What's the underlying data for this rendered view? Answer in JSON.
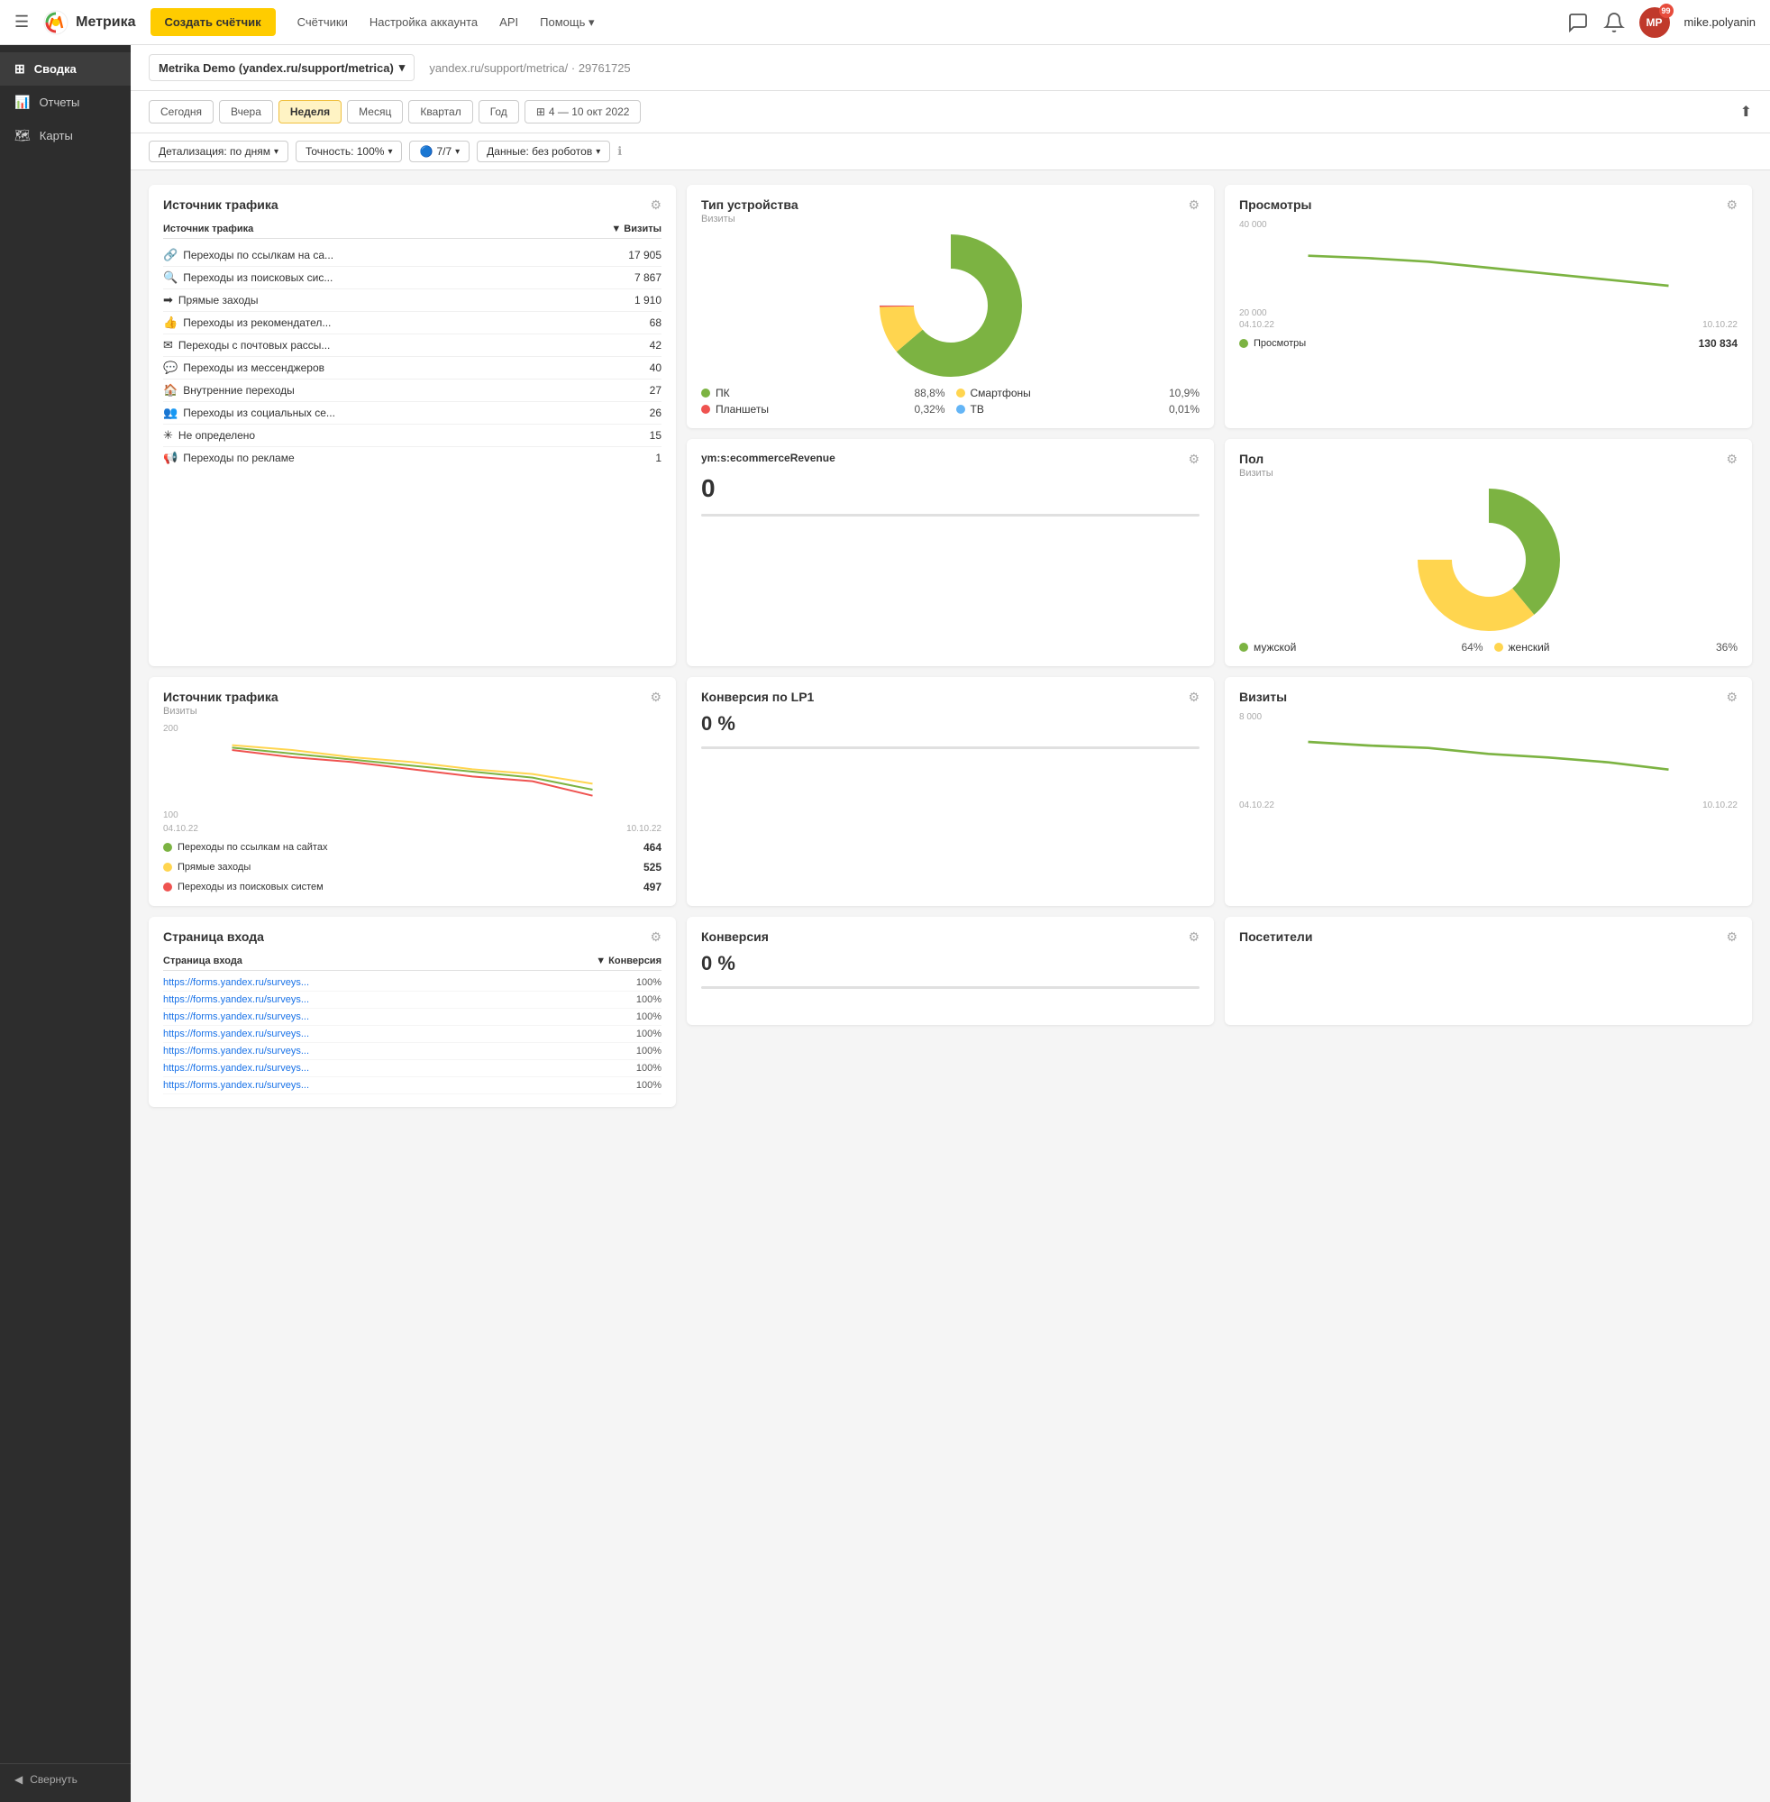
{
  "header": {
    "menu_icon": "☰",
    "logo_text": "Метрика",
    "create_btn": "Создать счётчик",
    "nav": [
      "Счётчики",
      "Настройка аккаунта",
      "API",
      "Помощь ▾"
    ],
    "username": "mike.polyanin",
    "notification_count": "99"
  },
  "sidebar": {
    "items": [
      {
        "label": "Сводка",
        "icon": "⊞",
        "active": true
      },
      {
        "label": "Отчеты",
        "icon": "📊",
        "active": false
      },
      {
        "label": "Карты",
        "icon": "🗺",
        "active": false
      }
    ],
    "collapse_label": "Свернуть"
  },
  "account": {
    "name": "Metrika Demo (yandex.ru/support/metrica)",
    "url": "yandex.ru/support/metrica/",
    "id": "29761725"
  },
  "date_filters": {
    "buttons": [
      "Сегодня",
      "Вчера",
      "Неделя",
      "Месяц",
      "Квартал",
      "Год"
    ],
    "active": "Неделя",
    "range_icon": "⊞",
    "range": "4 — 10 окт 2022",
    "export_icon": "⬆"
  },
  "detail_filters": {
    "detail": "Детализация: по дням",
    "accuracy": "Точность: 100%",
    "counters": "7/7",
    "data": "Данные: без роботов",
    "info_icon": "ℹ"
  },
  "widgets": {
    "traffic_source": {
      "title": "Источник трафика",
      "gear": "⚙",
      "col_source": "Источник трафика",
      "col_visits": "▼ Визиты",
      "rows": [
        {
          "icon": "🔗",
          "color": "#4a9fd4",
          "name": "Переходы по ссылкам на са...",
          "value": "17 905"
        },
        {
          "icon": "🔍",
          "color": "#e67e22",
          "name": "Переходы из поисковых сис...",
          "value": "7 867"
        },
        {
          "icon": "➡",
          "color": "#7f8c8d",
          "name": "Прямые заходы",
          "value": "1 910"
        },
        {
          "icon": "👍",
          "color": "#e91e8c",
          "name": "Переходы из рекомендател...",
          "value": "68"
        },
        {
          "icon": "✉",
          "color": "#e67e22",
          "name": "Переходы с почтовых рассы...",
          "value": "42"
        },
        {
          "icon": "💬",
          "color": "#3498db",
          "name": "Переходы из мессенджеров",
          "value": "40"
        },
        {
          "icon": "🏠",
          "color": "#27ae60",
          "name": "Внутренние переходы",
          "value": "27"
        },
        {
          "icon": "👥",
          "color": "#9b59b6",
          "name": "Переходы из социальных се...",
          "value": "26"
        },
        {
          "icon": "✳",
          "color": "#95a5a6",
          "name": "Не определено",
          "value": "15"
        },
        {
          "icon": "📢",
          "color": "#e67e22",
          "name": "Переходы по рекламе",
          "value": "1"
        }
      ]
    },
    "device_type": {
      "title": "Тип устройства",
      "subtitle": "Визиты",
      "gear": "⚙",
      "chart": {
        "segments": [
          {
            "label": "ПК",
            "value": 88.8,
            "color": "#7cb342",
            "pct": "88,8%"
          },
          {
            "label": "Смартфоны",
            "value": 10.9,
            "color": "#ffd54f",
            "pct": "10,9%"
          },
          {
            "label": "Планшеты",
            "value": 0.32,
            "color": "#ef5350",
            "pct": "0,32%"
          },
          {
            "label": "ТВ",
            "value": 0.01,
            "color": "#64b5f6",
            "pct": "0,01%"
          }
        ]
      }
    },
    "views": {
      "title": "Просмотры",
      "gear": "⚙",
      "y_labels": [
        "40 000",
        "20 000"
      ],
      "x_labels": [
        "04.10.22",
        "10.10.22"
      ],
      "legend_label": "Просмотры",
      "legend_color": "#7cb342",
      "legend_value": "130 834"
    },
    "ecommerce": {
      "title": "ym:s:ecommerceRevenue",
      "gear": "⚙",
      "value": "0"
    },
    "gender": {
      "title": "Пол",
      "subtitle": "Визиты",
      "gear": "⚙",
      "chart": {
        "segments": [
          {
            "label": "мужской",
            "value": 64,
            "color": "#7cb342",
            "pct": "64%"
          },
          {
            "label": "женский",
            "value": 36,
            "color": "#ffd54f",
            "pct": "36%"
          }
        ]
      }
    },
    "traffic_source_chart": {
      "title": "Источник трафика",
      "subtitle": "Визиты",
      "gear": "⚙",
      "y_labels": [
        "200",
        "100"
      ],
      "x_labels": [
        "04.10.22",
        "10.10.22"
      ],
      "series": [
        {
          "label": "Переходы по ссылкам на сайтах",
          "color": "#7cb342",
          "value": "464"
        },
        {
          "label": "Прямые заходы",
          "color": "#ffd54f",
          "value": "525"
        },
        {
          "label": "Переходы из поисковых систем",
          "color": "#ef5350",
          "value": "497"
        }
      ]
    },
    "conversion_lp1": {
      "title": "Конверсия по LP1",
      "gear": "⚙",
      "value": "0 %"
    },
    "visits": {
      "title": "Визиты",
      "gear": "⚙",
      "y_label": "8 000"
    },
    "conversion": {
      "title": "Конверсия",
      "gear": "⚙",
      "value": "0 %"
    },
    "landing_page": {
      "title": "Страница входа",
      "gear": "⚙",
      "col_page": "Страница входа",
      "col_conv": "▼ Конверсия",
      "rows": [
        {
          "url": "https://forms.yandex.ru/surveys...",
          "conv": "100%"
        },
        {
          "url": "https://forms.yandex.ru/surveys...",
          "conv": "100%"
        },
        {
          "url": "https://forms.yandex.ru/surveys...",
          "conv": "100%"
        },
        {
          "url": "https://forms.yandex.ru/surveys...",
          "conv": "100%"
        },
        {
          "url": "https://forms.yandex.ru/surveys...",
          "conv": "100%"
        },
        {
          "url": "https://forms.yandex.ru/surveys...",
          "conv": "100%"
        },
        {
          "url": "https://forms.yandex.ru/surveys...",
          "conv": "100%"
        }
      ]
    },
    "visitors": {
      "title": "Посетители",
      "gear": "⚙"
    }
  }
}
